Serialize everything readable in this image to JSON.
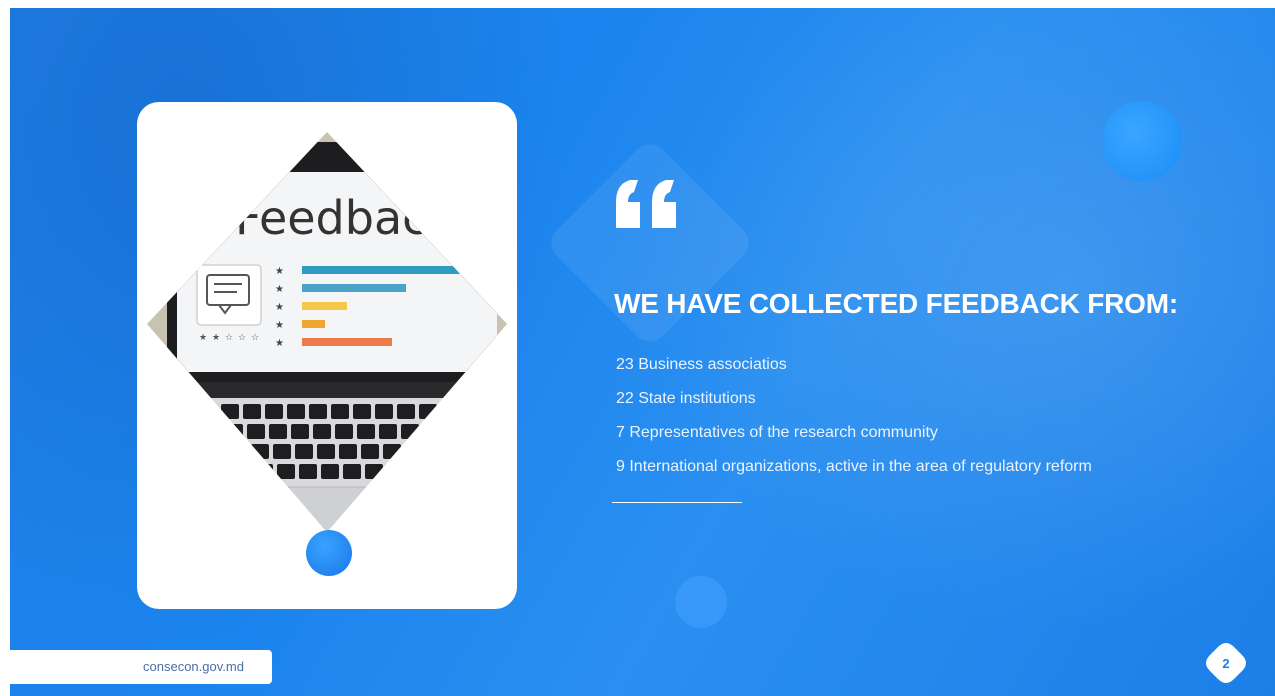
{
  "slide": {
    "title": "WE HAVE COLLECTED FEEDBACK FROM:",
    "items": [
      "23 Business associatios",
      "22 State  institutions",
      "7 Representatives of the research community",
      "9 International  organizations, active in the area of regulatory reform"
    ],
    "website": "consecon.gov.md",
    "page_number": "2"
  },
  "image": {
    "screen_heading": "Feedbac",
    "rating_bars": [
      0.98,
      0.58,
      0.25,
      0.13,
      0.5
    ],
    "rating_colors": [
      "#2f9bc1",
      "#4aa3c9",
      "#f5c84a",
      "#f0a531",
      "#ee7a4a"
    ],
    "rated_stars": 2,
    "total_stars": 5
  },
  "colors": {
    "background": "#1f7fe6",
    "accent_dot": "#1a8cf6",
    "text": "#ffffff"
  },
  "icons": [
    "quote-icon",
    "chat-bubble-icon",
    "star-icon"
  ]
}
